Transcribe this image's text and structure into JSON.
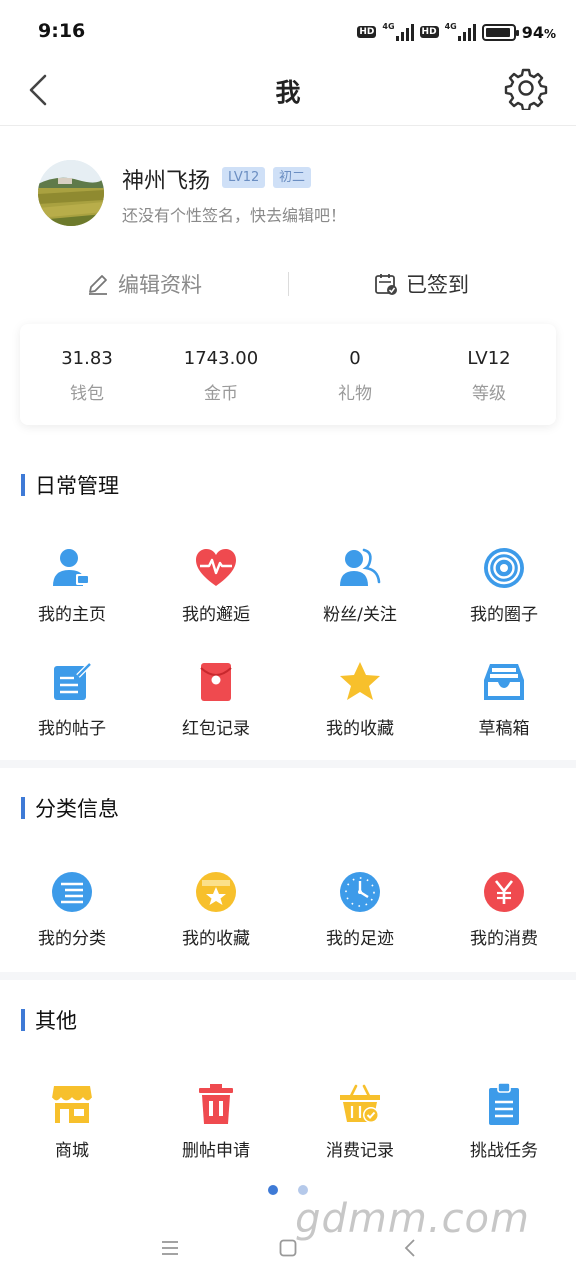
{
  "status_bar": {
    "time": "9:16",
    "hd1": "HD",
    "net1": "4G",
    "hd2": "HD",
    "net2": "4G",
    "battery_percent": "94",
    "battery_unit": "%"
  },
  "header": {
    "title": "我",
    "back_icon": "chevron-left-icon",
    "settings_icon": "gear-icon"
  },
  "profile": {
    "username": "神州飞扬",
    "level_badge": "LV12",
    "grade_badge": "初二",
    "signature": "还没有个性签名，快去编辑吧！",
    "edit_label": "编辑资料",
    "signed_label": "已签到"
  },
  "stats": [
    {
      "value": "31.83",
      "label": "钱包"
    },
    {
      "value": "1743.00",
      "label": "金币"
    },
    {
      "value": "0",
      "label": "礼物"
    },
    {
      "value": "LV12",
      "label": "等级"
    }
  ],
  "sections": {
    "daily": {
      "title": "日常管理",
      "items": [
        {
          "label": "我的主页",
          "icon": "user-card-icon"
        },
        {
          "label": "我的邂逅",
          "icon": "heart-pulse-icon"
        },
        {
          "label": "粉丝/关注",
          "icon": "users-icon"
        },
        {
          "label": "我的圈子",
          "icon": "target-icon"
        },
        {
          "label": "我的帖子",
          "icon": "edit-note-icon"
        },
        {
          "label": "红包记录",
          "icon": "red-envelope-icon"
        },
        {
          "label": "我的收藏",
          "icon": "star-icon"
        },
        {
          "label": "草稿箱",
          "icon": "inbox-tray-icon"
        }
      ]
    },
    "category": {
      "title": "分类信息",
      "items": [
        {
          "label": "我的分类",
          "icon": "list-circle-icon"
        },
        {
          "label": "我的收藏",
          "icon": "star-box-icon"
        },
        {
          "label": "我的足迹",
          "icon": "clock-icon"
        },
        {
          "label": "我的消费",
          "icon": "yen-icon"
        }
      ]
    },
    "other": {
      "title": "其他",
      "items": [
        {
          "label": "商城",
          "icon": "shop-icon"
        },
        {
          "label": "删帖申请",
          "icon": "trash-icon"
        },
        {
          "label": "消费记录",
          "icon": "basket-check-icon"
        },
        {
          "label": "挑战任务",
          "icon": "clipboard-icon"
        }
      ]
    }
  },
  "pager": {
    "active_color": "#3e7ad6",
    "inactive_color": "#b5c9ea"
  },
  "watermark": "gdmm.com",
  "colors": {
    "accent": "#3e7ad6",
    "blue_icon": "#3d9be9",
    "red_icon": "#ef4a4f",
    "yellow_icon": "#f7c02c"
  }
}
